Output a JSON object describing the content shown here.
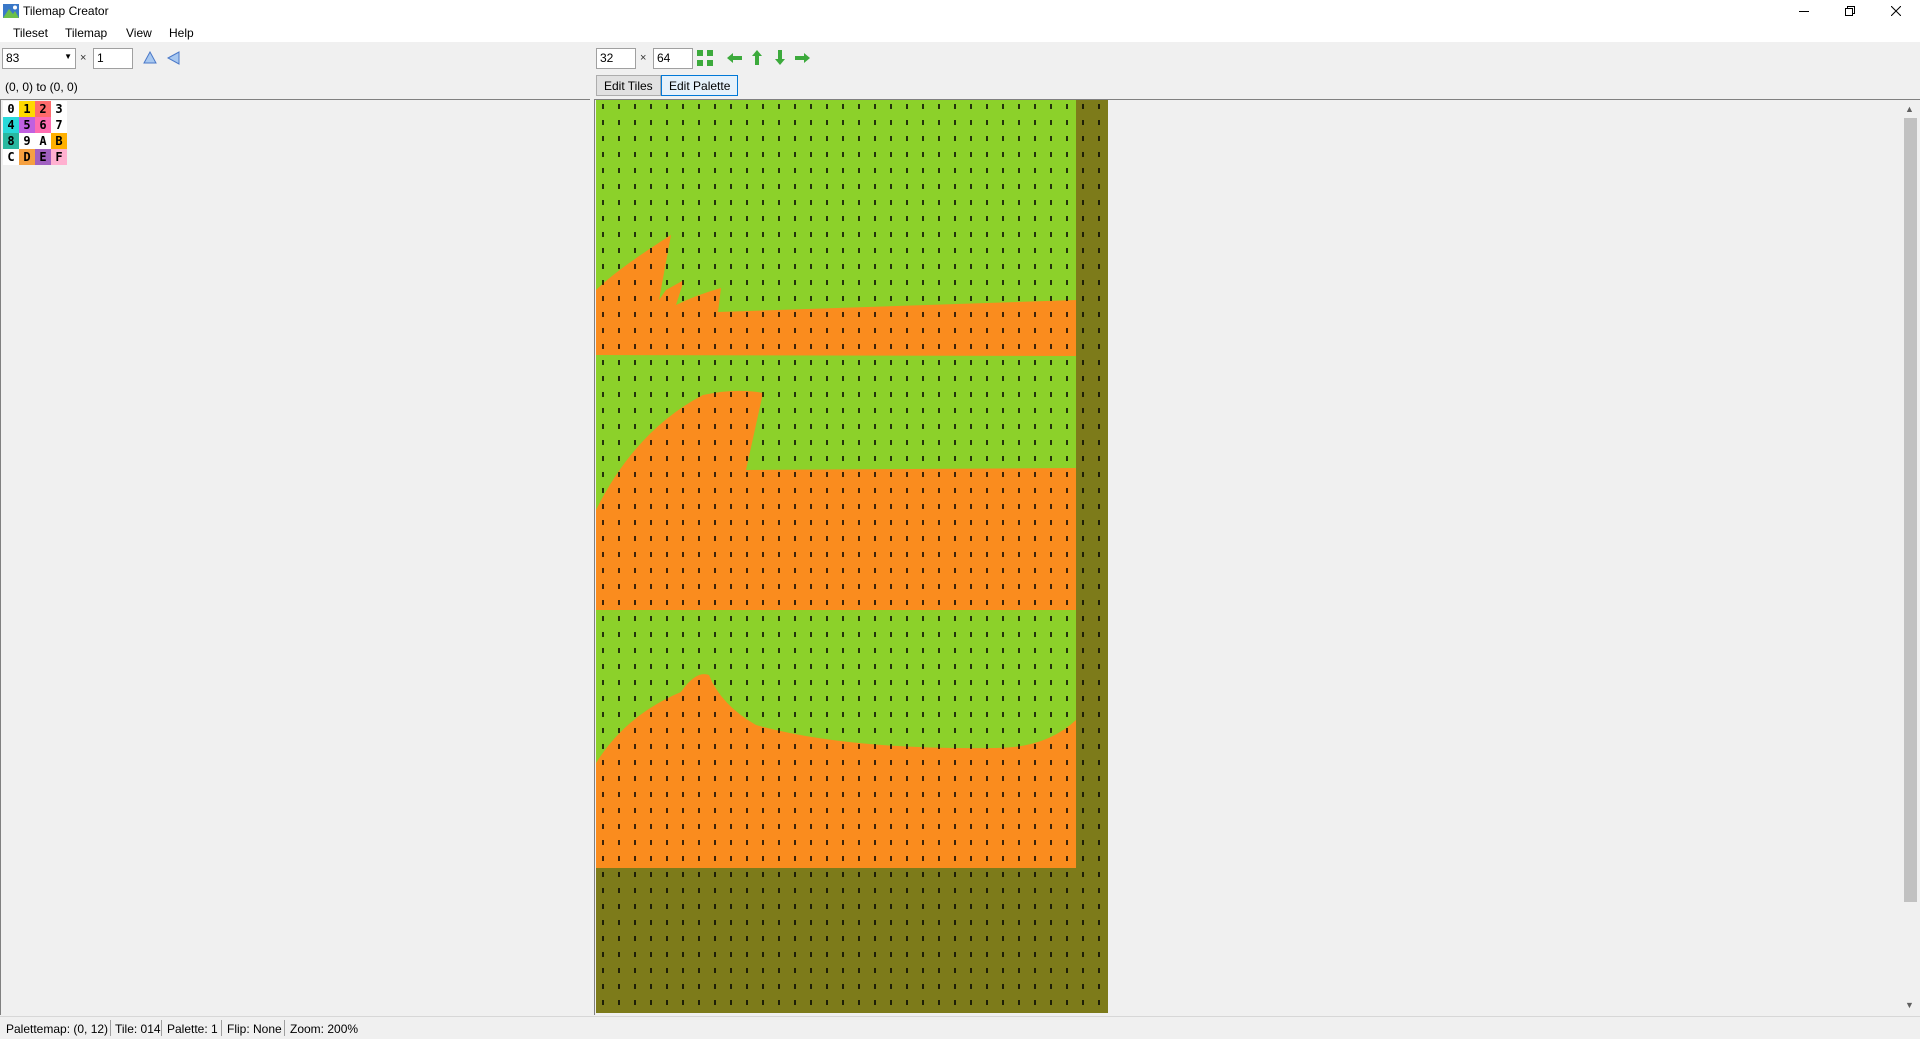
{
  "window": {
    "title": "Tilemap Creator"
  },
  "menu": [
    "Tileset",
    "Tilemap",
    "View",
    "Help"
  ],
  "tileset_toolbar": {
    "count_value": "83",
    "x_symbol": "×",
    "height_value": "1"
  },
  "selection_text": "(0, 0) to (0, 0)",
  "map_toolbar": {
    "width_value": "32",
    "x_symbol": "×",
    "height_value": "64",
    "edit_tiles_label": "Edit Tiles",
    "edit_palette_label": "Edit Palette"
  },
  "palette_grid": [
    {
      "label": "0",
      "bg": "#ffffff"
    },
    {
      "label": "1",
      "bg": "#ffd800"
    },
    {
      "label": "2",
      "bg": "#ff6b6b"
    },
    {
      "label": "3",
      "bg": "#ffffff"
    },
    {
      "label": "4",
      "bg": "#29d9d9"
    },
    {
      "label": "5",
      "bg": "#c060e0"
    },
    {
      "label": "6",
      "bg": "#ff6cb0"
    },
    {
      "label": "7",
      "bg": "#ffffff"
    },
    {
      "label": "8",
      "bg": "#29b8a0"
    },
    {
      "label": "9",
      "bg": "#ffffff"
    },
    {
      "label": "A",
      "bg": "#ffffff"
    },
    {
      "label": "B",
      "bg": "#ffb000"
    },
    {
      "label": "C",
      "bg": "#ffffff"
    },
    {
      "label": "D",
      "bg": "#f5a040"
    },
    {
      "label": "E",
      "bg": "#a060c0"
    },
    {
      "label": "F",
      "bg": "#ffb0d0"
    }
  ],
  "map_colors": {
    "green": "#8cd12a",
    "orange": "#fa8c1e",
    "olive": "#7d7b1a"
  },
  "status": {
    "palettemap": "Palettemap: (0, 12)",
    "tile": "Tile: 014",
    "palette": "Palette: 1",
    "flip": "Flip: None",
    "zoom": "Zoom: 200%"
  }
}
